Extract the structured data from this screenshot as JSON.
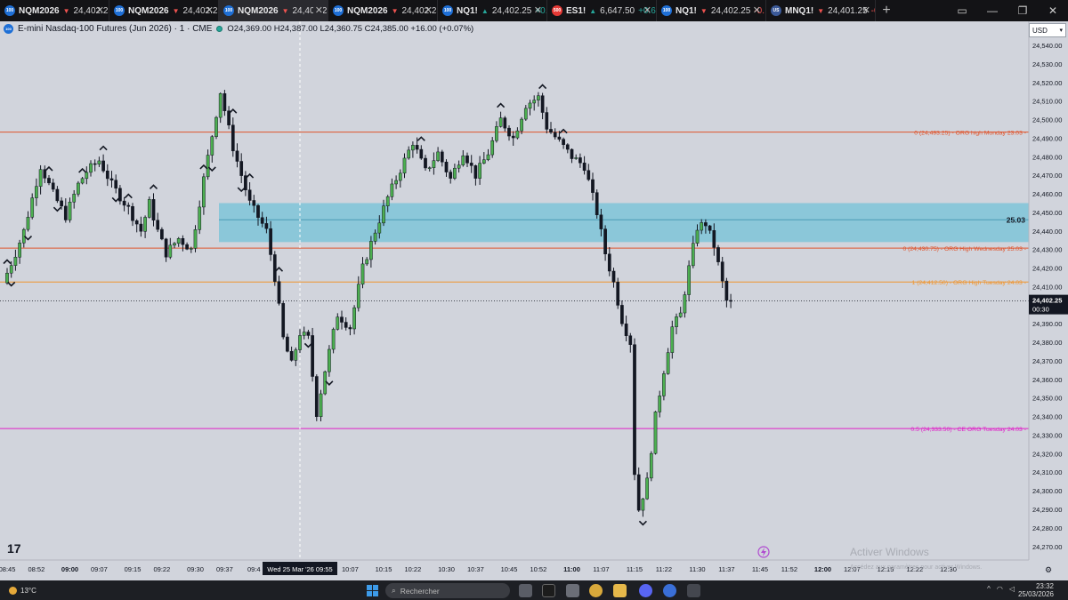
{
  "tabs": [
    {
      "badge": "100",
      "badge_color": "#1e6fd6",
      "symbol": "NQM2026",
      "dir": "▼",
      "dir_color": "#ef5350",
      "price": "24,402.25",
      "active": false
    },
    {
      "badge": "100",
      "badge_color": "#1e6fd6",
      "symbol": "NQM2026",
      "dir": "▼",
      "dir_color": "#ef5350",
      "price": "24,402.25",
      "active": false
    },
    {
      "badge": "100",
      "badge_color": "#1e6fd6",
      "symbol": "NQM2026",
      "dir": "▼",
      "dir_color": "#ef5350",
      "price": "24,402.25",
      "active": true
    },
    {
      "badge": "100",
      "badge_color": "#1e6fd6",
      "symbol": "NQM2026",
      "dir": "▼",
      "dir_color": "#ef5350",
      "price": "24,402.25",
      "active": false
    },
    {
      "badge": "100",
      "badge_color": "#1e6fd6",
      "symbol": "NQ1!",
      "dir": "▲",
      "dir_color": "#26a69a",
      "price": "24,402.25",
      "extra": "+0.",
      "active": false
    },
    {
      "badge": "500",
      "badge_color": "#e53935",
      "symbol": "ES1!",
      "dir": "▲",
      "dir_color": "#26a69a",
      "price": "6,647.50",
      "extra": "+0.67",
      "active": false
    },
    {
      "badge": "100",
      "badge_color": "#1e6fd6",
      "symbol": "NQ1!",
      "dir": "▼",
      "dir_color": "#ef5350",
      "price": "24,402.25",
      "extra": "-0.",
      "active": false
    },
    {
      "badge": "US",
      "badge_color": "#3b5998",
      "symbol": "MNQ1!",
      "dir": "▼",
      "dir_color": "#ef5350",
      "price": "24,401.25",
      "extra": "-0.",
      "active": false
    }
  ],
  "legend": {
    "logo": "100",
    "title": "E-mini Nasdaq-100 Futures (Jun 2026) · 1 · CME",
    "ohlc": "O24,369.00 H24,387.00 L24,360.75 C24,385.00 +16.00 (+0.07%)"
  },
  "currency": "USD",
  "chart_data": {
    "type": "candlestick",
    "interval": "1m",
    "y_ticks": [
      24270,
      24280,
      24290,
      24300,
      24310,
      24320,
      24330,
      24340,
      24350,
      24360,
      24370,
      24380,
      24390,
      24400,
      24410,
      24420,
      24430,
      24440,
      24450,
      24460,
      24470,
      24480,
      24490,
      24500,
      24510,
      24520,
      24530,
      24540
    ],
    "y_tick_labels": [
      "24,270.00",
      "24,280.00",
      "24,290.00",
      "24,300.00",
      "24,310.00",
      "24,320.00",
      "24,330.00",
      "24,340.00",
      "24,350.00",
      "24,360.00",
      "24,370.00",
      "24,380.00",
      "24,390.00",
      "24,400.00",
      "24,410.00",
      "24,420.00",
      "24,430.00",
      "24,440.00",
      "24,450.00",
      "24,460.00",
      "24,470.00",
      "24,480.00",
      "24,490.00",
      "24,500.00",
      "24,510.00",
      "24,520.00",
      "24,530.00",
      "24,540.00"
    ],
    "x_labels": [
      {
        "t": 0,
        "text": "08:45"
      },
      {
        "t": 7,
        "text": "08:52"
      },
      {
        "t": 15,
        "text": "09:00",
        "bold": true
      },
      {
        "t": 22,
        "text": "09:07"
      },
      {
        "t": 30,
        "text": "09:15"
      },
      {
        "t": 37,
        "text": "09:22"
      },
      {
        "t": 45,
        "text": "09:30"
      },
      {
        "t": 52,
        "text": "09:37"
      },
      {
        "t": 59,
        "text": "09:4"
      },
      {
        "t": 82,
        "text": "10:07"
      },
      {
        "t": 90,
        "text": "10:15"
      },
      {
        "t": 97,
        "text": "10:22"
      },
      {
        "t": 105,
        "text": "10:30"
      },
      {
        "t": 112,
        "text": "10:37"
      },
      {
        "t": 120,
        "text": "10:45"
      },
      {
        "t": 127,
        "text": "10:52"
      },
      {
        "t": 135,
        "text": "11:00",
        "bold": true
      },
      {
        "t": 142,
        "text": "11:07"
      },
      {
        "t": 150,
        "text": "11:15"
      },
      {
        "t": 157,
        "text": "11:22"
      },
      {
        "t": 165,
        "text": "11:30"
      },
      {
        "t": 172,
        "text": "11:37"
      },
      {
        "t": 180,
        "text": "11:45"
      },
      {
        "t": 187,
        "text": "11:52"
      },
      {
        "t": 195,
        "text": "12:00",
        "bold": true
      },
      {
        "t": 202,
        "text": "12:07"
      },
      {
        "t": 210,
        "text": "12:15"
      },
      {
        "t": 217,
        "text": "12:22"
      },
      {
        "t": 225,
        "text": "12:30"
      }
    ],
    "crosshair": {
      "t": 70,
      "label": "Wed 25 Mar '26  09:55"
    },
    "zone": {
      "top": 24455,
      "bottom": 24434,
      "mid": 24446,
      "label": "25.03",
      "color": "#7fc4d8"
    },
    "levels": [
      {
        "price": 24493.25,
        "color": "#e0532b",
        "label": "0 (24,493.25) - ORG high Monday 23.03 -"
      },
      {
        "price": 24430.75,
        "color": "#e0532b",
        "label": "0 (24,430.75) - ORG High Wednesday 25.03 -"
      },
      {
        "price": 24412.5,
        "color": "#f0942c",
        "label": "1 (24,412.50) - ORG High Tuesday 24.03 -"
      },
      {
        "price": 24333.5,
        "color": "#e020c8",
        "label": "0.5 (24,333.50) - CE ORG Tuesday 24.03 -"
      }
    ],
    "last_price": {
      "price": 24402.25,
      "label": "24,402.25",
      "countdown": "00:30"
    },
    "anchors": [
      [
        0,
        24412
      ],
      [
        3,
        24428
      ],
      [
        5,
        24440
      ],
      [
        9,
        24475
      ],
      [
        12,
        24460
      ],
      [
        15,
        24448
      ],
      [
        18,
        24465
      ],
      [
        20,
        24472
      ],
      [
        23,
        24478
      ],
      [
        26,
        24465
      ],
      [
        30,
        24452
      ],
      [
        33,
        24440
      ],
      [
        35,
        24455
      ],
      [
        37,
        24440
      ],
      [
        39,
        24428
      ],
      [
        42,
        24436
      ],
      [
        45,
        24430
      ],
      [
        48,
        24468
      ],
      [
        52,
        24515
      ],
      [
        55,
        24485
      ],
      [
        59,
        24455
      ],
      [
        63,
        24440
      ],
      [
        65,
        24415
      ],
      [
        67,
        24382
      ],
      [
        69,
        24368
      ],
      [
        71,
        24385
      ],
      [
        73,
        24382
      ],
      [
        75,
        24342
      ],
      [
        77,
        24365
      ],
      [
        80,
        24395
      ],
      [
        83,
        24388
      ],
      [
        86,
        24420
      ],
      [
        89,
        24440
      ],
      [
        92,
        24458
      ],
      [
        95,
        24473
      ],
      [
        98,
        24488
      ],
      [
        101,
        24472
      ],
      [
        104,
        24482
      ],
      [
        107,
        24468
      ],
      [
        110,
        24483
      ],
      [
        113,
        24470
      ],
      [
        116,
        24482
      ],
      [
        119,
        24500
      ],
      [
        122,
        24490
      ],
      [
        125,
        24508
      ],
      [
        128,
        24512
      ],
      [
        130,
        24496
      ],
      [
        133,
        24488
      ],
      [
        136,
        24480
      ],
      [
        139,
        24475
      ],
      [
        142,
        24450
      ],
      [
        144,
        24428
      ],
      [
        146,
        24412
      ],
      [
        148,
        24392
      ],
      [
        150,
        24380
      ],
      [
        151,
        24310
      ],
      [
        152,
        24290
      ],
      [
        154,
        24305
      ],
      [
        156,
        24340
      ],
      [
        158,
        24365
      ],
      [
        160,
        24388
      ],
      [
        162,
        24395
      ],
      [
        164,
        24420
      ],
      [
        166,
        24442
      ],
      [
        168,
        24444
      ],
      [
        170,
        24432
      ],
      [
        172,
        24412
      ],
      [
        173,
        24402.25
      ]
    ],
    "up_markers": [
      0,
      10,
      18,
      23,
      29,
      35,
      47,
      54,
      58,
      65,
      99,
      118,
      128,
      133
    ],
    "down_markers": [
      1,
      5,
      12,
      26,
      49,
      56,
      72,
      77,
      152
    ]
  },
  "crosshair_time": "Wed 25 Mar '26  09:55",
  "watermark": {
    "line1": "Activer Windows",
    "line2": "Accédez aux paramètres pour activer Windows."
  },
  "tv_logo": "17",
  "taskbar": {
    "weather": "13°C",
    "search_placeholder": "Rechercher",
    "time": "23:32",
    "date": "25/03/2026"
  }
}
